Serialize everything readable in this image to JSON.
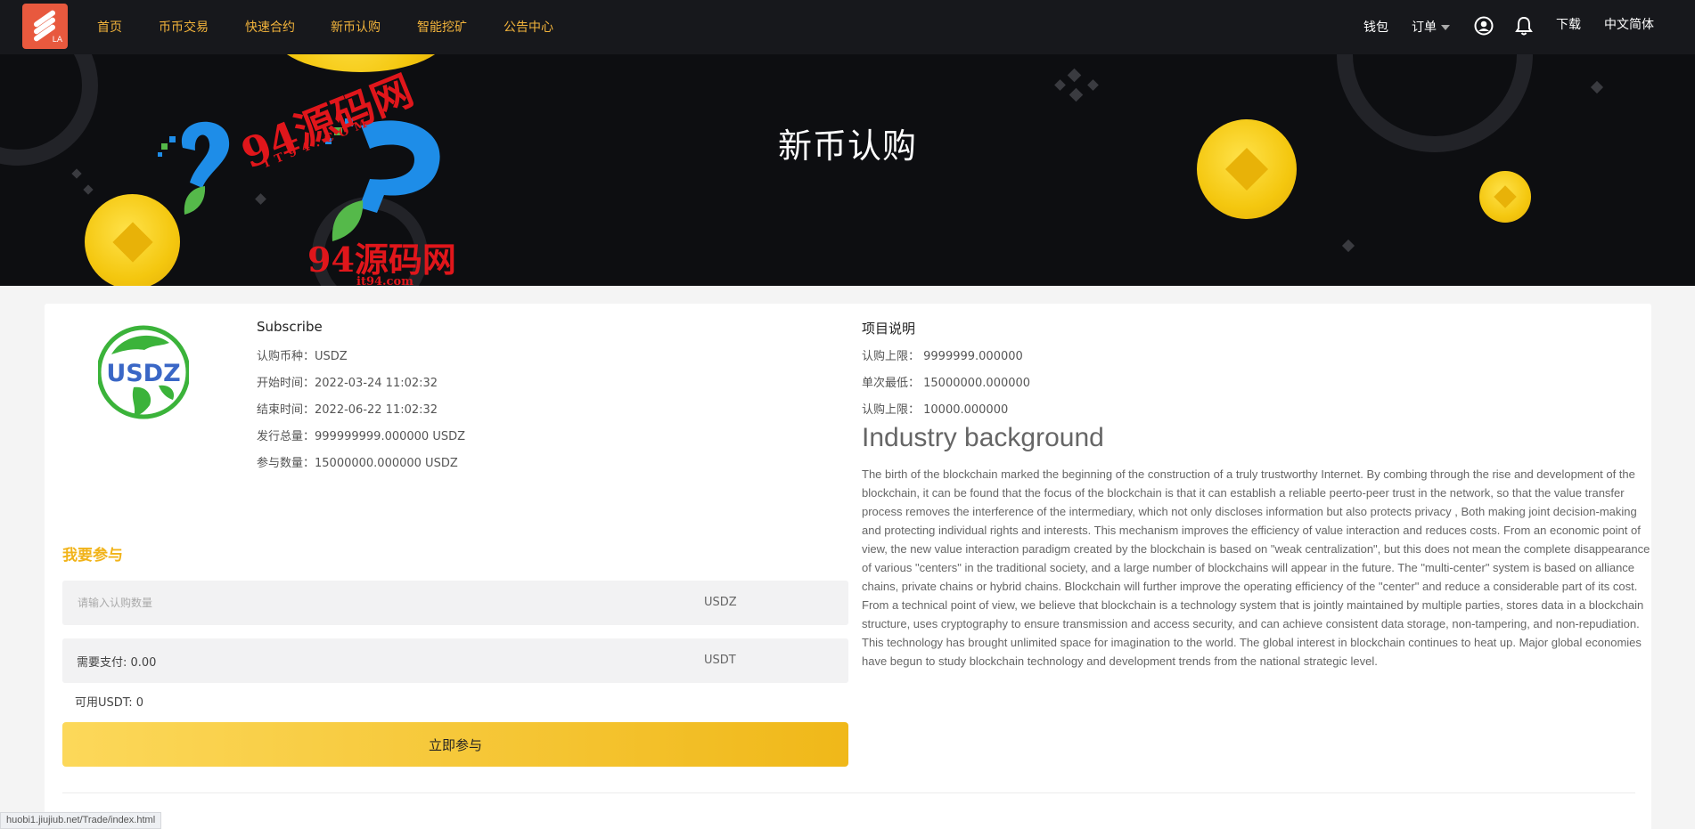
{
  "nav": {
    "logo_text": "LA",
    "links": [
      "首页",
      "币币交易",
      "快速合约",
      "新币认购",
      "智能挖矿",
      "公告中心"
    ],
    "wallet": "钱包",
    "orders": "订单",
    "download": "下载",
    "language": "中文简体"
  },
  "banner": {
    "title": "新币认购"
  },
  "coin": {
    "logo_text": "USDZ",
    "info_title": "Subscribe",
    "rows": [
      "认购币种：USDZ",
      "开始时间：2022-03-24 11:02:32",
      "结束时间：2022-06-22 11:02:32",
      "发行总量：999999999.000000 USDZ",
      "参与数量：15000000.000000 USDZ"
    ]
  },
  "project": {
    "title": "项目说明",
    "rows": [
      "认购上限： 9999999.000000",
      "单次最低： 15000000.000000",
      "认购上限： 10000.000000"
    ],
    "industry_title": "Industry background",
    "industry_text": "The birth of the blockchain marked the beginning of the construction of a truly trustworthy Internet. By combing through the rise and development of the blockchain, it can be found that the focus of the blockchain is that it can establish a reliable peerto-peer trust in the network, so that the value transfer process removes the interference of the intermediary, which not only discloses information but also protects privacy , Both making joint decision-making and protecting individual rights and interests. This mechanism improves the efficiency of value interaction and reduces costs. From an economic point of view, the new value interaction paradigm created by the blockchain is based on \"weak centralization\", but this does not mean the complete disappearance of various \"centers\" in the traditional society, and a large number of blockchains will appear in the future. The \"multi-center\" system is based on alliance chains, private chains or hybrid chains. Blockchain will further improve the operating efficiency of the \"center\" and reduce a considerable part of its cost. From a technical point of view, we believe that blockchain is a technology system that is jointly maintained by multiple parties, stores data in a blockchain structure, uses cryptography to ensure transmission and access security, and can achieve consistent data storage, non-tampering, and non-repudiation. This technology has brought unlimited space for imagination to the world. The global interest in blockchain continues to heat up. Major global economies have begun to study blockchain technology and development trends from the national strategic level."
  },
  "join": {
    "title": "我要参与",
    "amount_placeholder": "请输入认购数量",
    "amount_value": "",
    "amount_unit": "USDZ",
    "pay_label": "需要支付:  0.00",
    "pay_unit": "USDT",
    "available": "可用USDT:  0",
    "submit": "立即参与"
  },
  "status_url": "huobi1.jiujiub.net/Trade/index.html",
  "watermark": {
    "main": "94源码网",
    "sub1": "IT94.COM",
    "sub2": "it94.com"
  },
  "colors": {
    "accent": "#f1b319",
    "nav_bg": "#17181c",
    "banner_bg": "#0d0e11"
  }
}
